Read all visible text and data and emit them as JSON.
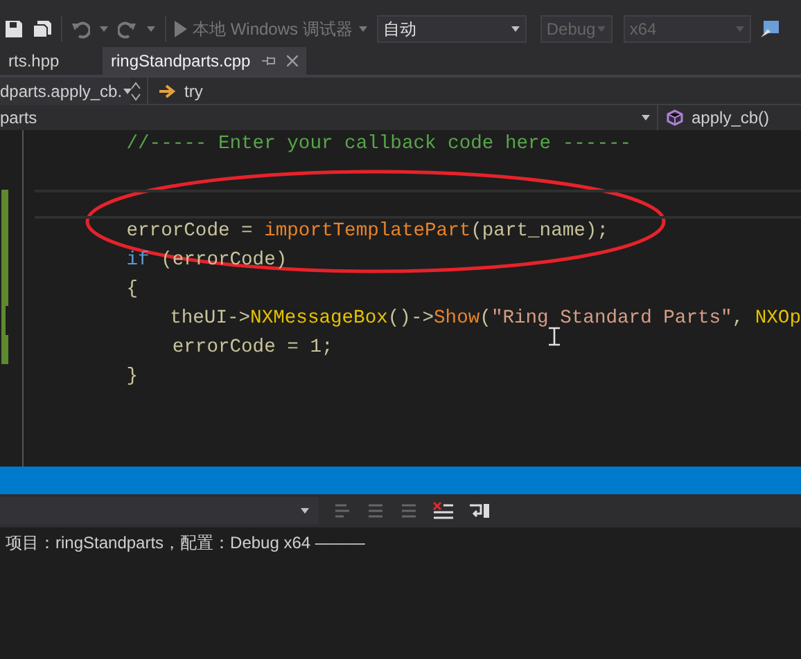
{
  "toolbar": {
    "debugger_label": "本地 Windows 调试器",
    "solution_config": "自动",
    "configuration": "Debug",
    "platform": "x64"
  },
  "tabs": [
    {
      "label": "rts.hpp",
      "selected": false
    },
    {
      "label": "ringStandparts.cpp",
      "selected": true
    }
  ],
  "nav_bar": {
    "scope": "dparts.apply_cb.",
    "member": "try"
  },
  "nav_bar_2": {
    "project": "parts",
    "function": "apply_cb()"
  },
  "editor": {
    "lines": [
      {
        "changed": false,
        "current": false,
        "tokens": [
          {
            "kind": "comment",
            "text": "        //----- Enter your callback code here ------"
          }
        ]
      },
      {
        "changed": false,
        "current": false
      },
      {
        "changed": true,
        "current": true
      },
      {
        "changed": true,
        "current": false,
        "tokens": [
          {
            "kind": "plain",
            "text": "        errorCode = "
          },
          {
            "kind": "function",
            "text": "importTemplatePart"
          },
          {
            "kind": "plain",
            "text": "(part_name);"
          }
        ]
      },
      {
        "changed": true,
        "current": false,
        "tokens": [
          {
            "kind": "keyword",
            "text": "        if"
          },
          {
            "kind": "plain",
            "text": " (errorCode)"
          }
        ]
      },
      {
        "changed": true,
        "current": false,
        "tokens": [
          {
            "kind": "plain",
            "text": "        {"
          }
        ]
      },
      {
        "changed": true,
        "current": false,
        "tokens": [
          {
            "kind": "plain",
            "text": "            theUI->"
          },
          {
            "kind": "type",
            "text": "NXMessageBox"
          },
          {
            "kind": "plain",
            "text": "()->"
          },
          {
            "kind": "function",
            "text": "Show"
          },
          {
            "kind": "plain",
            "text": "("
          },
          {
            "kind": "string",
            "text": "\"Ring Standard Parts\""
          },
          {
            "kind": "plain",
            "text": ", "
          },
          {
            "kind": "type",
            "text": "NXOp"
          }
        ]
      },
      {
        "changed": true,
        "current": false,
        "tokens": [
          {
            "kind": "plain",
            "text": "            errorCode = 1;"
          }
        ]
      },
      {
        "changed": false,
        "current": false,
        "tokens": [
          {
            "kind": "plain",
            "text": "        }"
          }
        ]
      }
    ]
  },
  "output": {
    "text": "项目：ringStandparts，配置：Debug x64 ———"
  }
}
